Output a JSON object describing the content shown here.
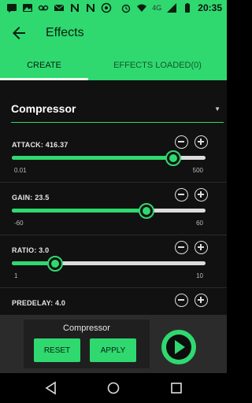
{
  "status_bar": {
    "time": "20:35",
    "network": "4G",
    "icons": [
      "message-icon",
      "image-icon",
      "voicemail-icon",
      "mail-icon",
      "n-app-icon",
      "n-app-icon",
      "notification-icon",
      "alarm-icon",
      "wifi-icon",
      "signal-icon",
      "battery-icon"
    ]
  },
  "app_bar": {
    "title": "Effects"
  },
  "tabs": [
    {
      "label": "CREATE",
      "selected": true
    },
    {
      "label": "EFFECTS LOADED(0)",
      "selected": false
    }
  ],
  "effect_selector": {
    "selected": "Compressor"
  },
  "params": [
    {
      "label": "ATTACK: 416.37",
      "min": "0.01",
      "max": "500",
      "min_value": 0.01,
      "max_value": 500,
      "value": 416.37
    },
    {
      "label": "GAIN: 23.5",
      "min": "-60",
      "max": "60",
      "min_value": -60,
      "max_value": 60,
      "value": 23.5
    },
    {
      "label": "RATIO: 3.0",
      "min": "1",
      "max": "10",
      "min_value": 1,
      "max_value": 10,
      "value": 3.0
    },
    {
      "label": "PREDELAY: 4.0"
    }
  ],
  "bottom": {
    "effect_name": "Compressor",
    "reset_label": "RESET",
    "apply_label": "APPLY"
  },
  "colors": {
    "accent": "#2fd96f",
    "background": "#111111",
    "panel": "#2b2b2b"
  }
}
